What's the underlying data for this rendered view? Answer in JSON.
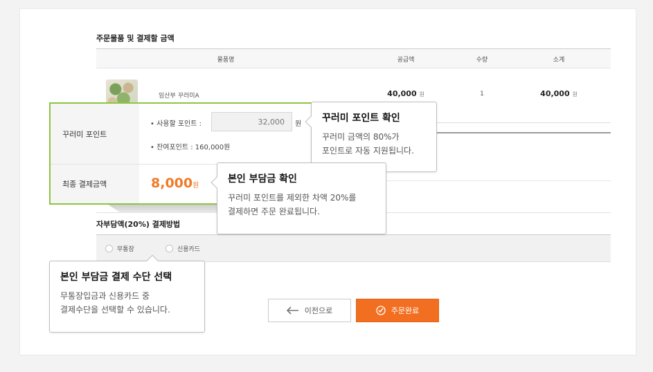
{
  "order": {
    "section_title": "주문물품 및 결제할 금액",
    "columns": [
      "물품명",
      "공급액",
      "수량",
      "소계"
    ],
    "item": {
      "name": "임산부 꾸러미A",
      "price": "40,000",
      "price_unit": "원",
      "quantity": "1",
      "subtotal": "40,000",
      "subtotal_unit": "원"
    }
  },
  "points": {
    "label": "꾸러미 포인트",
    "use_label": "• 사용할 포인트 :",
    "use_value": "32,000",
    "use_unit": "원",
    "remaining": "• 잔여포인트 : 160,000원"
  },
  "final": {
    "label": "최종 결제금액",
    "amount": "8,000",
    "unit": "원"
  },
  "payment": {
    "title": "자부담액(20%) 결제방법",
    "options": [
      "무통장",
      "신용카드"
    ]
  },
  "buttons": {
    "prev": "이전으로",
    "done": "주문완료"
  },
  "tooltips": {
    "point": {
      "title": "꾸러미 포인트 확인",
      "line1": "꾸러미 금액의 80%가",
      "line2": "포인트로 자동 지원됩니다."
    },
    "self": {
      "title": "본인 부담금 확인",
      "line1": "꾸러미 포인트를 제외한 차액 20%를",
      "line2": "결제하면 주문 완료됩니다."
    },
    "method": {
      "title": "본인 부담금 결제 수단 선택",
      "line1": "무통장입금과 신용카드 중",
      "line2": "결제수단을 선택할 수 있습니다."
    }
  },
  "colors": {
    "highlight": "#8cc63f",
    "accent": "#f26f21",
    "amount": "#f07a27"
  }
}
